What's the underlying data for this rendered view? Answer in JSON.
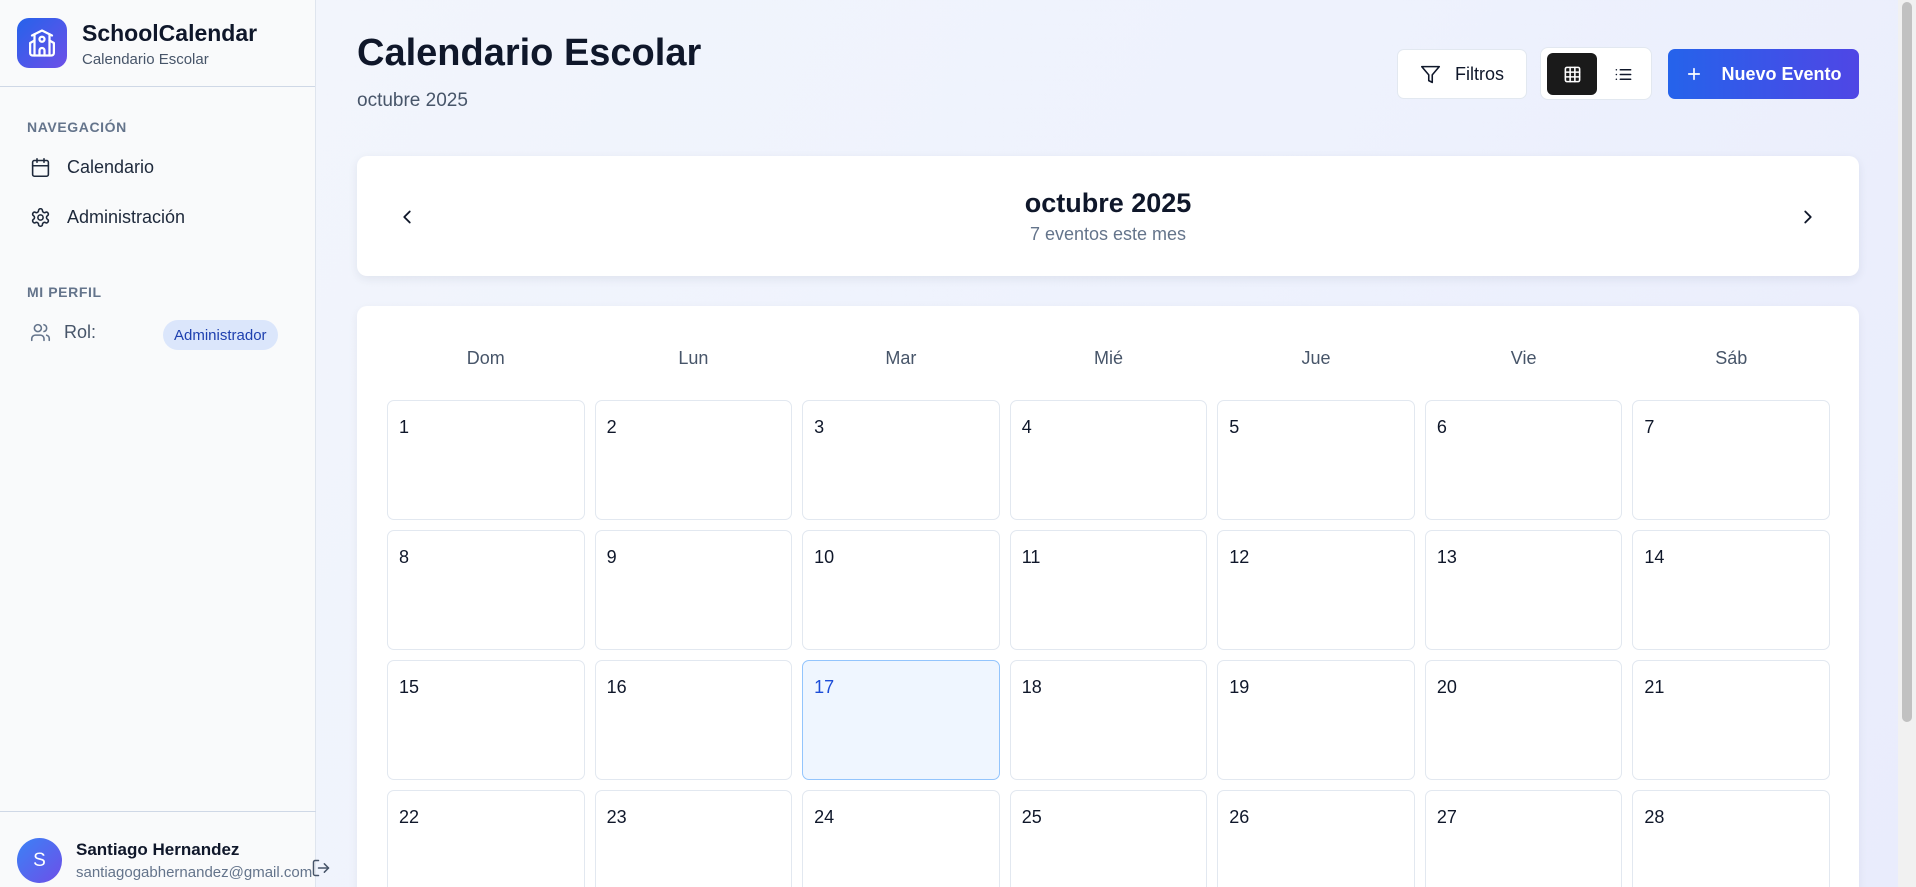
{
  "app": {
    "title": "SchoolCalendar",
    "subtitle": "Calendario Escolar"
  },
  "sidebar": {
    "nav_label": "NAVEGACIÓN",
    "items": [
      {
        "label": "Calendario",
        "icon": "calendar-icon"
      },
      {
        "label": "Administración",
        "icon": "gear-icon"
      }
    ],
    "profile_label": "MI PERFIL",
    "role_label": "Rol:",
    "role_value": "Administrador"
  },
  "user": {
    "initial": "S",
    "name": "Santiago Hernandez",
    "email": "santiagogabhernandez@gmail.com"
  },
  "header": {
    "title": "Calendario Escolar",
    "subtitle": "octubre 2025"
  },
  "toolbar": {
    "filter_label": "Filtros",
    "new_event_label": "Nuevo Evento"
  },
  "month_nav": {
    "title": "octubre 2025",
    "count": "7 eventos este mes"
  },
  "calendar": {
    "weekdays": [
      "Dom",
      "Lun",
      "Mar",
      "Mié",
      "Jue",
      "Vie",
      "Sáb"
    ],
    "days": [
      "1",
      "2",
      "3",
      "4",
      "5",
      "6",
      "7",
      "8",
      "9",
      "10",
      "11",
      "12",
      "13",
      "14",
      "15",
      "16",
      "17",
      "18",
      "19",
      "20",
      "21",
      "22",
      "23",
      "24",
      "25",
      "26",
      "27",
      "28"
    ],
    "today": "17"
  },
  "colors": {
    "accent": "#2563eb",
    "accent_2": "#4f46e5",
    "today_bg": "#eff6ff",
    "today_text": "#1d4ed8"
  }
}
